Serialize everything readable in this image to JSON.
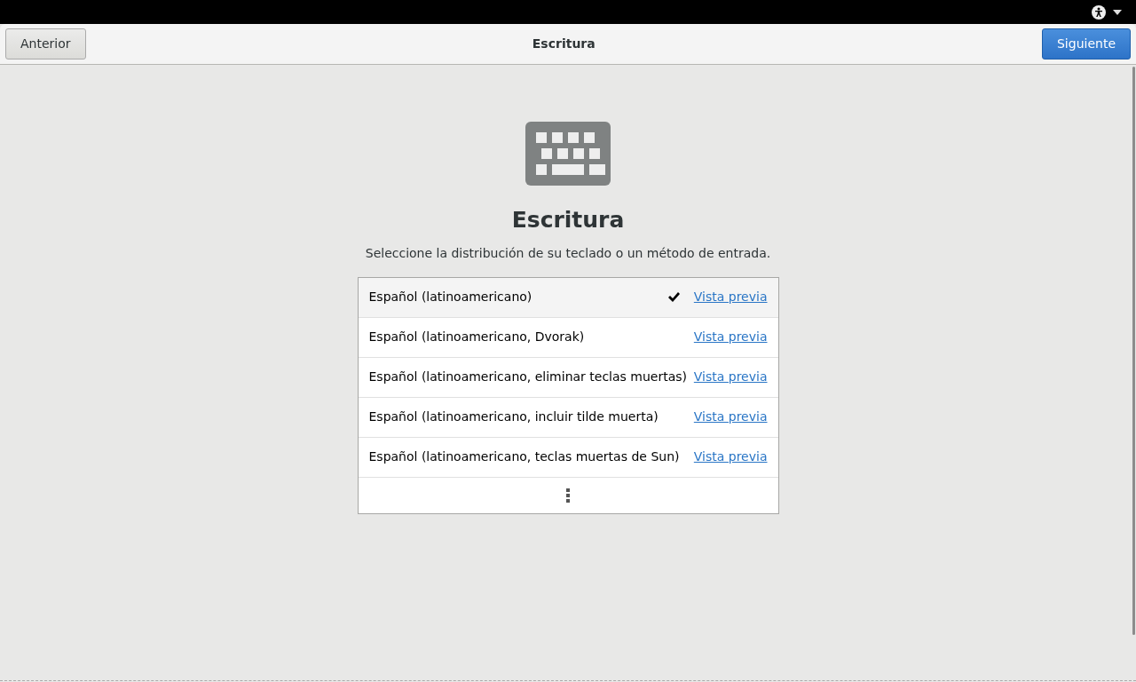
{
  "header": {
    "back_button": "Anterior",
    "title": "Escritura",
    "next_button": "Siguiente"
  },
  "page": {
    "heading": "Escritura",
    "subtitle": "Seleccione la distribución de su teclado o un método de entrada."
  },
  "layouts": [
    {
      "name": "Español (latinoamericano)",
      "selected": true,
      "preview": "Vista previa"
    },
    {
      "name": "Español (latinoamericano, Dvorak)",
      "selected": false,
      "preview": "Vista previa"
    },
    {
      "name": "Español (latinoamericano, eliminar teclas muertas)",
      "selected": false,
      "preview": "Vista previa"
    },
    {
      "name": "Español (latinoamericano, incluir tilde muerta)",
      "selected": false,
      "preview": "Vista previa"
    },
    {
      "name": "Español (latinoamericano, teclas muertas de Sun)",
      "selected": false,
      "preview": "Vista previa"
    }
  ]
}
